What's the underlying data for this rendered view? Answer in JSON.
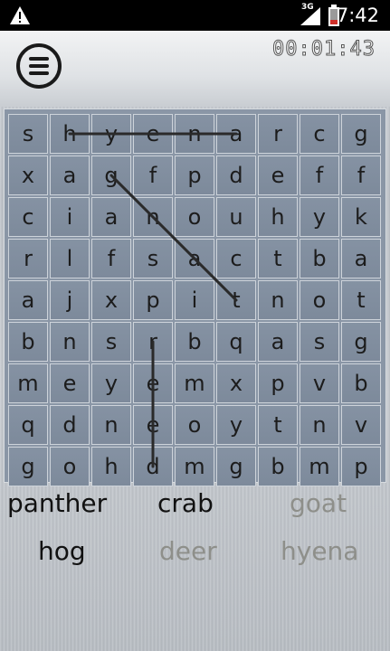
{
  "status_bar": {
    "network_label": "3G",
    "time": "7:42",
    "icons": [
      "warning-icon",
      "signal-icon",
      "battery-icon"
    ]
  },
  "header": {
    "timer": "00:01:43",
    "menu_icon": "hamburger-menu-icon"
  },
  "board": {
    "rows": [
      [
        "s",
        "h",
        "y",
        "e",
        "n",
        "a",
        "r",
        "c",
        "g"
      ],
      [
        "x",
        "a",
        "g",
        "f",
        "p",
        "d",
        "e",
        "f",
        "f"
      ],
      [
        "c",
        "i",
        "a",
        "n",
        "o",
        "u",
        "h",
        "y",
        "k"
      ],
      [
        "r",
        "l",
        "f",
        "s",
        "a",
        "c",
        "t",
        "b",
        "a"
      ],
      [
        "a",
        "j",
        "x",
        "p",
        "i",
        "t",
        "n",
        "o",
        "t"
      ],
      [
        "b",
        "n",
        "s",
        "r",
        "b",
        "q",
        "a",
        "s",
        "g"
      ],
      [
        "m",
        "e",
        "y",
        "e",
        "m",
        "x",
        "p",
        "v",
        "b"
      ],
      [
        "q",
        "d",
        "n",
        "e",
        "o",
        "y",
        "t",
        "n",
        "v"
      ],
      [
        "g",
        "o",
        "h",
        "d",
        "m",
        "g",
        "b",
        "m",
        "p"
      ]
    ],
    "strikes": [
      {
        "word": "hyena",
        "from": [
          0,
          1
        ],
        "to": [
          0,
          5
        ]
      },
      {
        "word": "goat",
        "from": [
          1,
          2
        ],
        "to": [
          4,
          5
        ]
      },
      {
        "word": "deer",
        "from": [
          5,
          3
        ],
        "to": [
          8,
          3
        ]
      }
    ]
  },
  "words": [
    {
      "text": "panther",
      "found": false
    },
    {
      "text": "crab",
      "found": false
    },
    {
      "text": "goat",
      "found": true
    },
    {
      "text": "hog",
      "found": false
    },
    {
      "text": "deer",
      "found": true
    },
    {
      "text": "hyena",
      "found": true
    }
  ],
  "colors": {
    "found_word": "#8e8f8a",
    "active_word": "#111111",
    "strike_line": "#2a2a2a"
  }
}
